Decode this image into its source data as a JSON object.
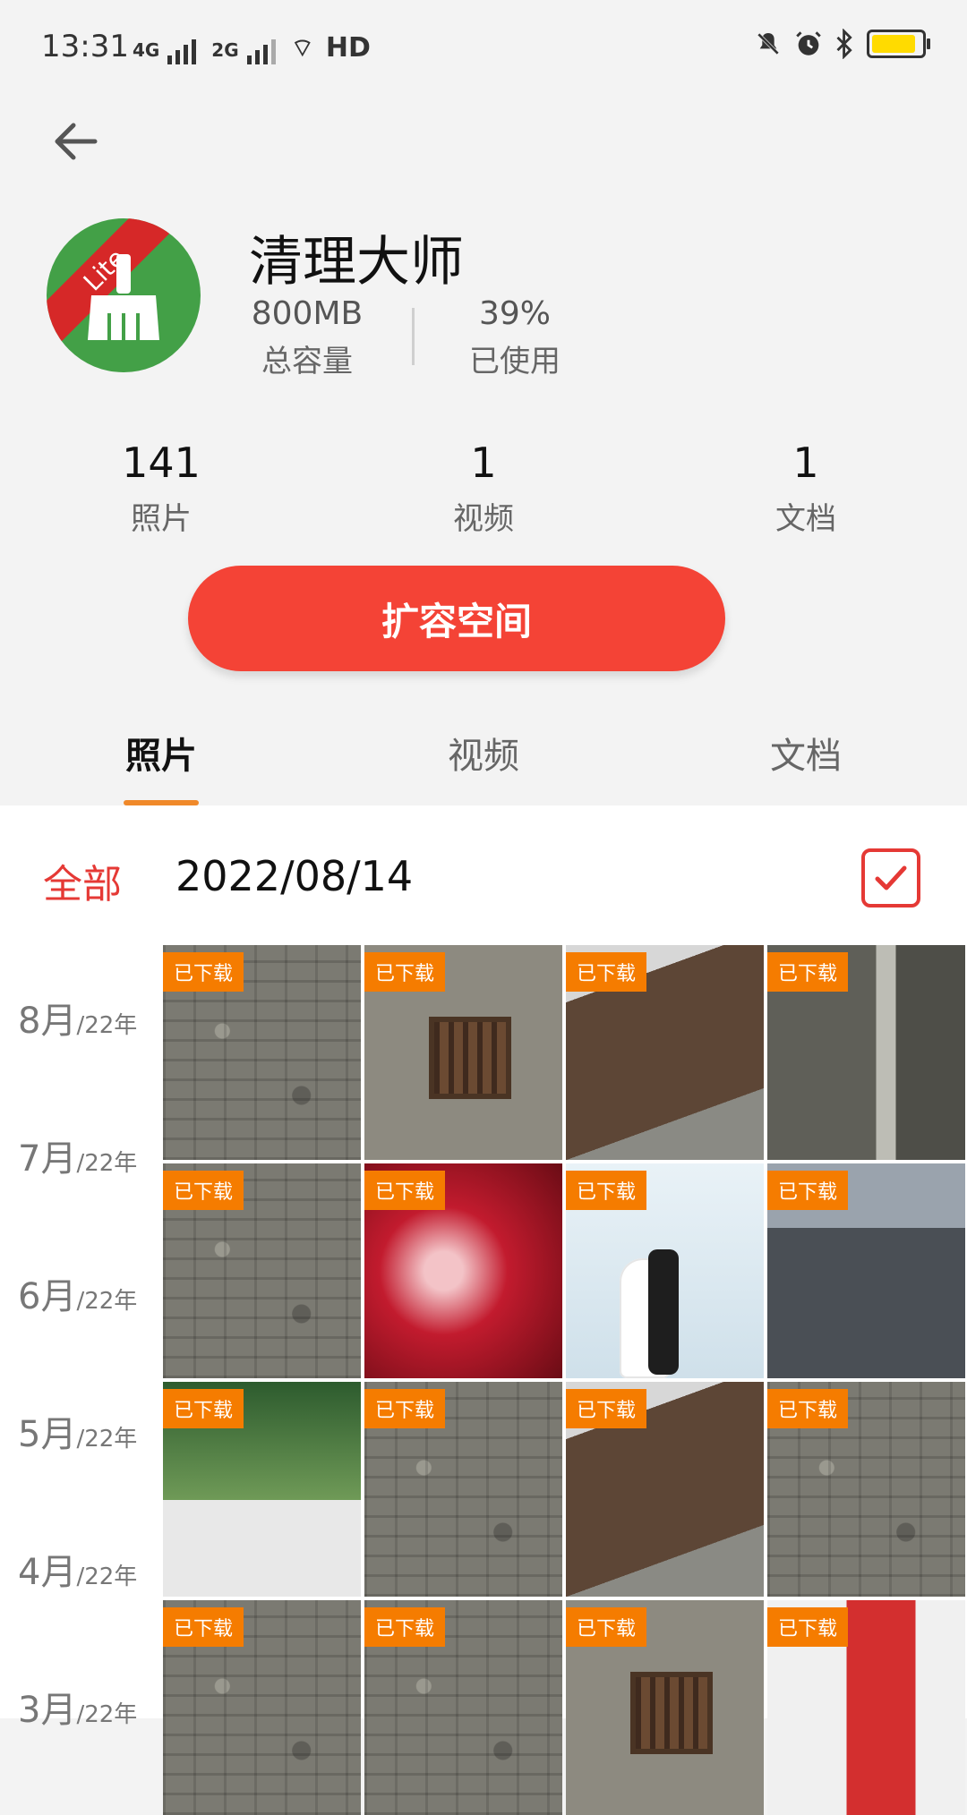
{
  "status_bar": {
    "time": "13:31",
    "network_left": "4G",
    "network_right": "2G",
    "hd": "HD",
    "icons": [
      "mute-icon",
      "alarm-icon",
      "bluetooth-icon",
      "battery-icon"
    ],
    "battery_color": "#ffdb00"
  },
  "header": {
    "back_icon": "back-arrow-icon",
    "app_badge": "Lite",
    "app_title": "清理大师",
    "capacity_value": "800MB",
    "capacity_label": "总容量",
    "used_value": "39%",
    "used_label": "已使用"
  },
  "stats": [
    {
      "count": "141",
      "label": "照片"
    },
    {
      "count": "1",
      "label": "视频"
    },
    {
      "count": "1",
      "label": "文档"
    }
  ],
  "expand_button": "扩容空间",
  "tabs": [
    {
      "label": "照片",
      "active": true
    },
    {
      "label": "视频",
      "active": false
    },
    {
      "label": "文档",
      "active": false
    }
  ],
  "filter": {
    "all_label": "全部",
    "date": "2022/08/14",
    "select_icon": "checkbox-checked-icon"
  },
  "timeline": [
    {
      "month": "8月",
      "year": "/22年"
    },
    {
      "month": "7月",
      "year": "/22年"
    },
    {
      "month": "6月",
      "year": "/22年"
    },
    {
      "month": "5月",
      "year": "/22年"
    },
    {
      "month": "4月",
      "year": "/22年"
    },
    {
      "month": "3月",
      "year": "/22年"
    }
  ],
  "photos": [
    {
      "badge": "已下载",
      "kind": "wall"
    },
    {
      "badge": "已下载",
      "kind": "wall-window"
    },
    {
      "badge": "已下载",
      "kind": "brown-wall"
    },
    {
      "badge": "已下载",
      "kind": "alley"
    },
    {
      "badge": "已下载",
      "kind": "wall"
    },
    {
      "badge": "已下载",
      "kind": "redposter"
    },
    {
      "badge": "已下载",
      "kind": "wedding"
    },
    {
      "badge": "已下载",
      "kind": "street"
    },
    {
      "badge": "已下载",
      "kind": "group"
    },
    {
      "badge": "已下载",
      "kind": "wall"
    },
    {
      "badge": "已下载",
      "kind": "brown-wall"
    },
    {
      "badge": "已下载",
      "kind": "wall"
    },
    {
      "badge": "已下载",
      "kind": "wall"
    },
    {
      "badge": "已下载",
      "kind": "wall"
    },
    {
      "badge": "已下载",
      "kind": "wall-window"
    },
    {
      "badge": "已下载",
      "kind": "redwed"
    }
  ],
  "colors": {
    "accent_red": "#f44336",
    "tab_indicator": "#f0892a",
    "badge_orange": "#f57c00"
  }
}
